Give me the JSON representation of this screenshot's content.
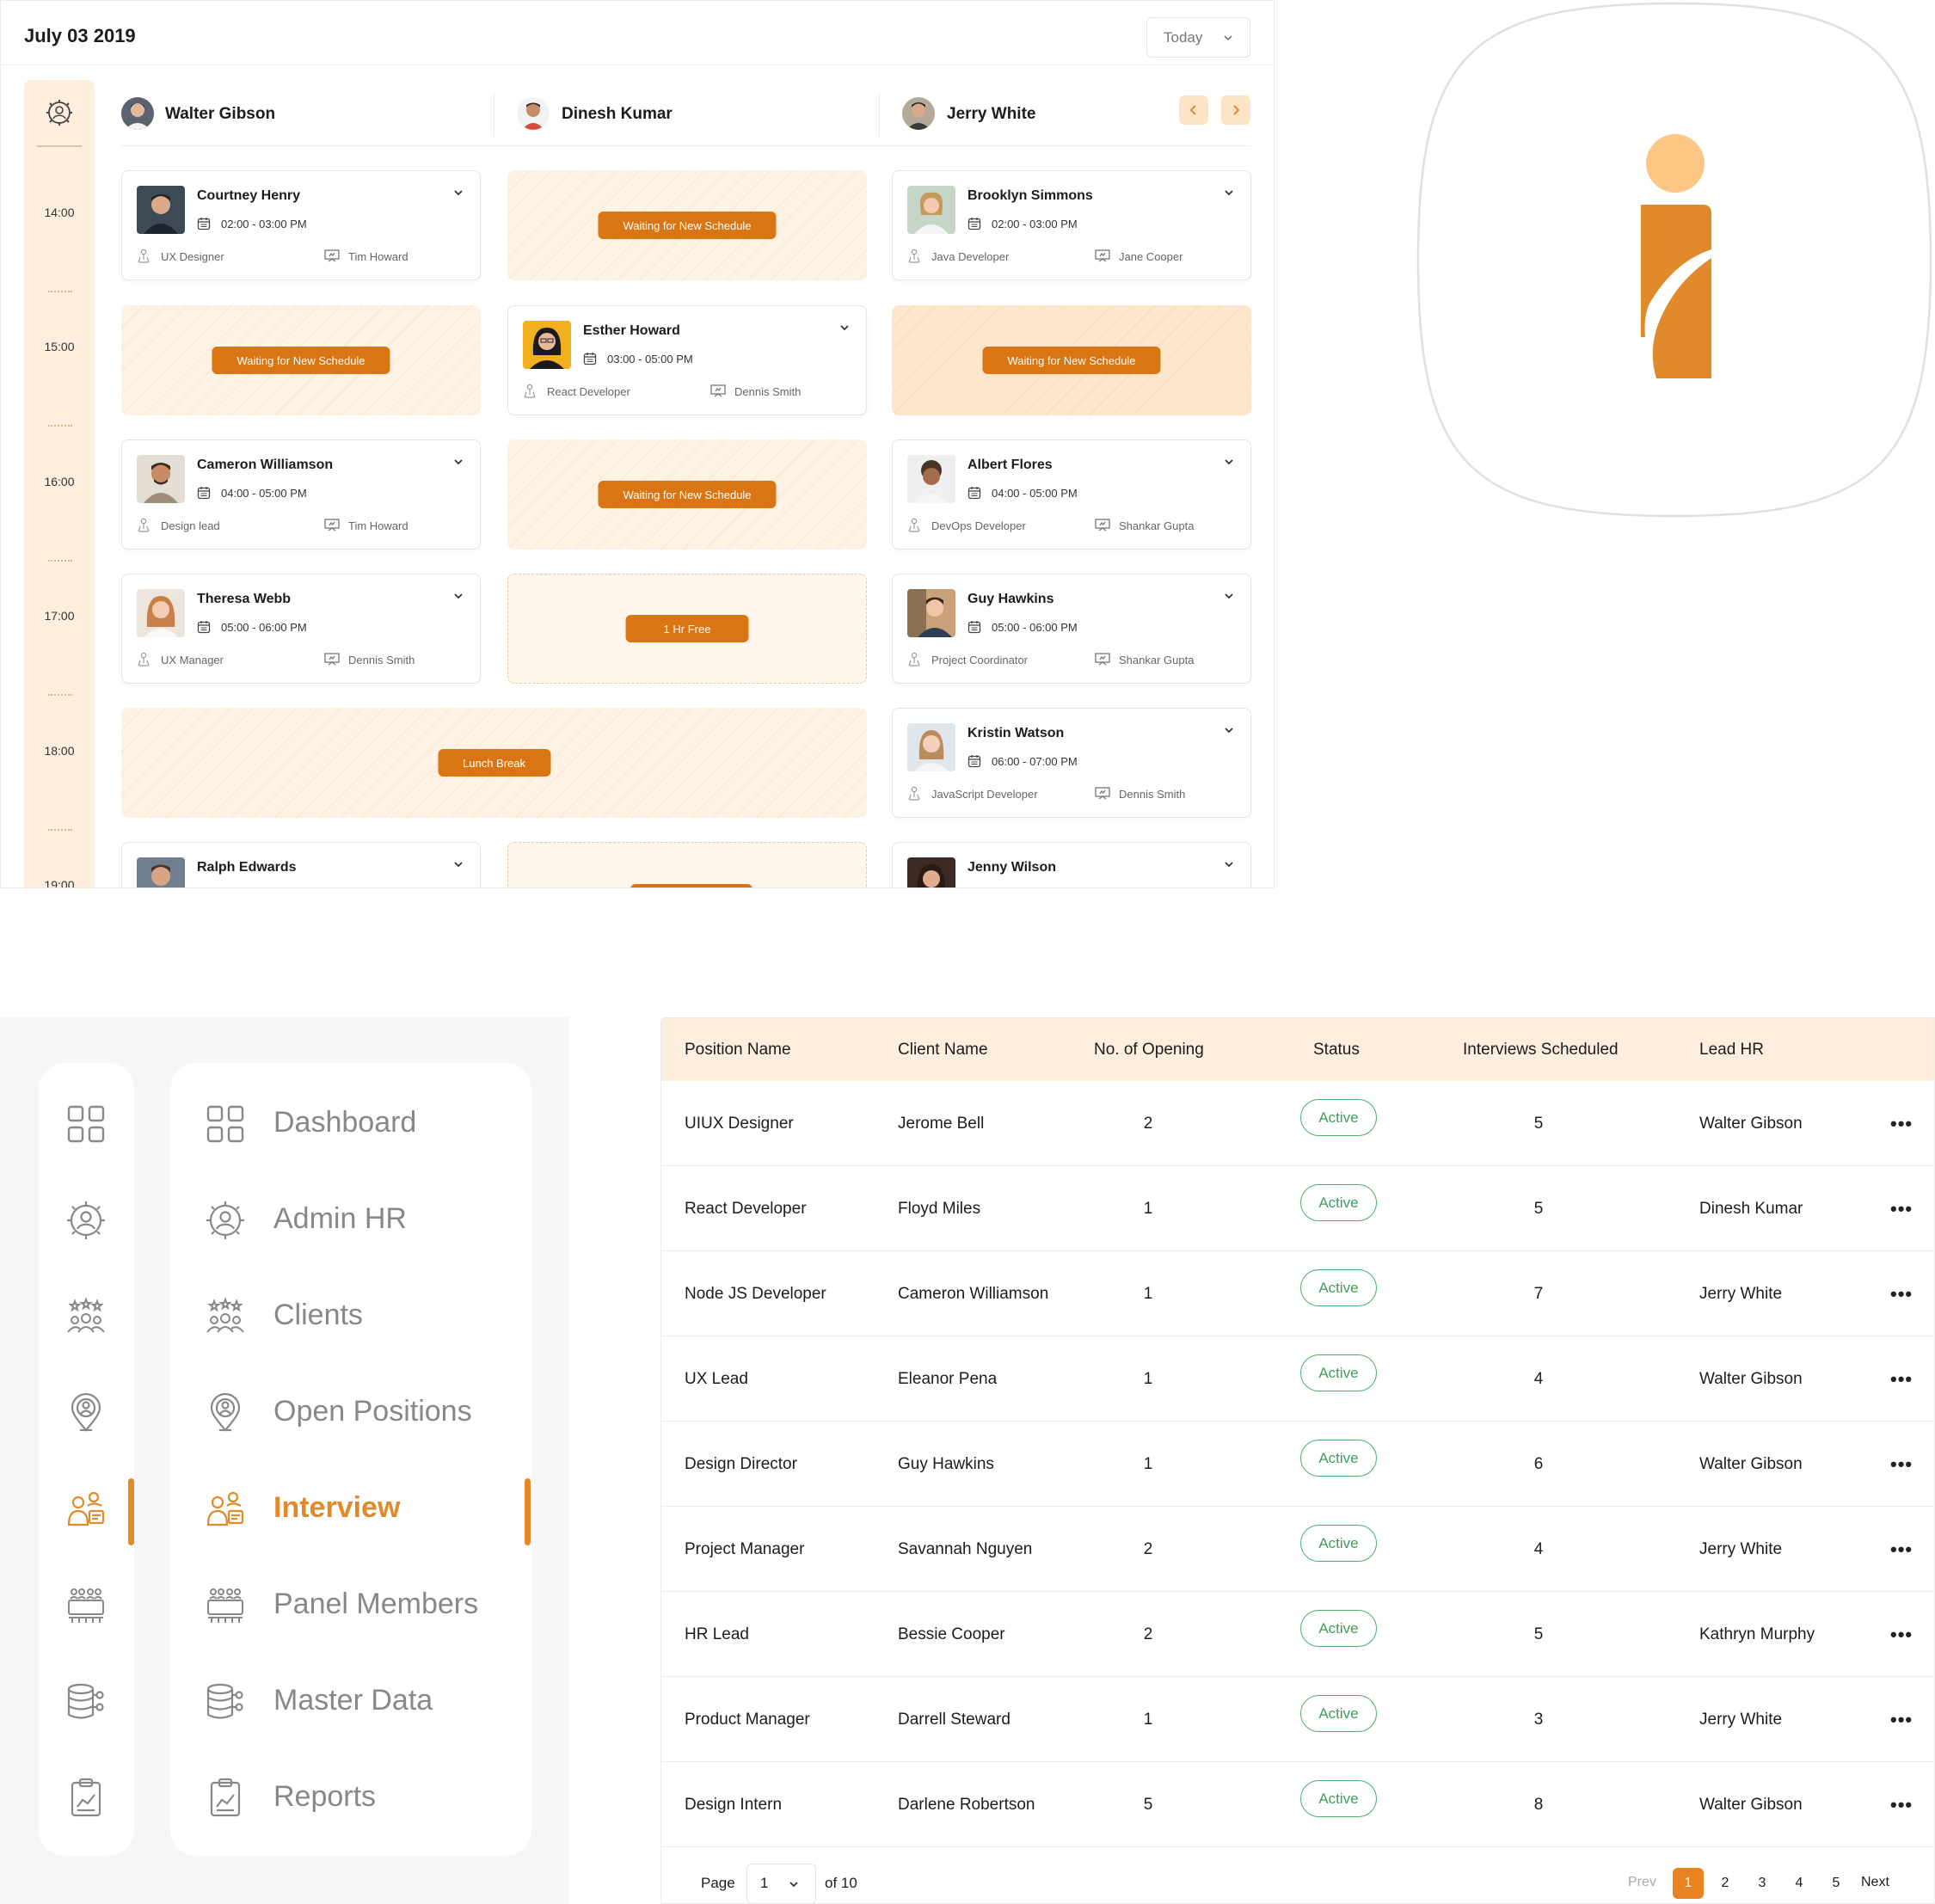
{
  "schedule": {
    "date": "July 03 2019",
    "view_select": "Today",
    "times": [
      "14:00",
      "15:00",
      "16:00",
      "17:00",
      "18:00",
      "19:00"
    ],
    "interviewers": [
      "Walter Gibson",
      "Dinesh Kumar",
      "Jerry White"
    ],
    "cards": {
      "courtney": {
        "name": "Courtney Henry",
        "time": "02:00 - 03:00 PM",
        "role": "UX Designer",
        "interviewer": "Tim Howard"
      },
      "brooklyn": {
        "name": "Brooklyn Simmons",
        "time": "02:00 - 03:00 PM",
        "role": "Java Developer",
        "interviewer": "Jane Cooper"
      },
      "esther": {
        "name": "Esther Howard",
        "time": "03:00 - 05:00 PM",
        "role": "React Developer",
        "interviewer": "Dennis Smith"
      },
      "cameron": {
        "name": "Cameron Williamson",
        "time": "04:00 - 05:00 PM",
        "role": "Design lead",
        "interviewer": "Tim Howard"
      },
      "albert": {
        "name": "Albert Flores",
        "time": "04:00 - 05:00 PM",
        "role": "DevOps Developer",
        "interviewer": "Shankar Gupta"
      },
      "theresa": {
        "name": "Theresa Webb",
        "time": "05:00 - 06:00 PM",
        "role": "UX Manager",
        "interviewer": "Dennis Smith"
      },
      "guy": {
        "name": "Guy Hawkins",
        "time": "05:00 - 06:00 PM",
        "role": "Project Coordinator",
        "interviewer": "Shankar Gupta"
      },
      "kristin": {
        "name": "Kristin Watson",
        "time": "06:00 - 07:00 PM",
        "role": "JavaScript Developer",
        "interviewer": "Dennis Smith"
      },
      "ralph": {
        "name": "Ralph Edwards"
      },
      "jenny": {
        "name": "Jenny Wilson"
      }
    },
    "waiting_label": "Waiting for New Schedule",
    "free_label": "1 Hr Free",
    "lunch_label": "Lunch Break"
  },
  "sidebar": {
    "items": [
      {
        "label": "Dashboard",
        "icon": "dashboard-grid-icon",
        "active": false
      },
      {
        "label": "Admin HR",
        "icon": "admin-gear-icon",
        "active": false
      },
      {
        "label": "Clients",
        "icon": "clients-group-icon",
        "active": false
      },
      {
        "label": "Open Positions",
        "icon": "location-pin-icon",
        "active": false
      },
      {
        "label": "Interview",
        "icon": "interview-people-icon",
        "active": true
      },
      {
        "label": "Panel Members",
        "icon": "panel-table-icon",
        "active": false
      },
      {
        "label": "Master Data",
        "icon": "database-icon",
        "active": false
      },
      {
        "label": "Reports",
        "icon": "report-clipboard-icon",
        "active": false
      }
    ]
  },
  "table": {
    "headers": [
      "Position Name",
      "Client Name",
      "No. of Opening",
      "Status",
      "Interviews Scheduled",
      "Lead HR"
    ],
    "rows": [
      {
        "position": "UIUX Designer",
        "client": "Jerome Bell",
        "openings": "2",
        "status": "Active",
        "scheduled": "5",
        "lead": "Walter Gibson"
      },
      {
        "position": "React Developer",
        "client": "Floyd Miles",
        "openings": "1",
        "status": "Active",
        "scheduled": "5",
        "lead": "Dinesh Kumar"
      },
      {
        "position": "Node JS Developer",
        "client": "Cameron Williamson",
        "openings": "1",
        "status": "Active",
        "scheduled": "7",
        "lead": "Jerry White"
      },
      {
        "position": "UX Lead",
        "client": "Eleanor Pena",
        "openings": "1",
        "status": "Active",
        "scheduled": "4",
        "lead": "Walter Gibson"
      },
      {
        "position": "Design Director",
        "client": "Guy Hawkins",
        "openings": "1",
        "status": "Active",
        "scheduled": "6",
        "lead": "Walter Gibson"
      },
      {
        "position": "Project Manager",
        "client": "Savannah Nguyen",
        "openings": "2",
        "status": "Active",
        "scheduled": "4",
        "lead": "Jerry White"
      },
      {
        "position": "HR Lead",
        "client": "Bessie Cooper",
        "openings": "2",
        "status": "Active",
        "scheduled": "5",
        "lead": "Kathryn Murphy"
      },
      {
        "position": "Product Manager",
        "client": "Darrell Steward",
        "openings": "1",
        "status": "Active",
        "scheduled": "3",
        "lead": "Jerry White"
      },
      {
        "position": "Design Intern",
        "client": "Darlene Robertson",
        "openings": "5",
        "status": "Active",
        "scheduled": "8",
        "lead": "Walter Gibson"
      }
    ],
    "row_action": "•••",
    "pagination": {
      "page_label": "Page",
      "page_value": "1",
      "of_label": "of 10",
      "prev": "Prev",
      "pages": [
        "1",
        "2",
        "3",
        "4",
        "5"
      ],
      "next": "Next"
    }
  },
  "colors": {
    "accent": "#e08a2c",
    "accent_dark": "#d97512",
    "peach": "#fdeedd",
    "status_green": "#3f9d5c"
  }
}
